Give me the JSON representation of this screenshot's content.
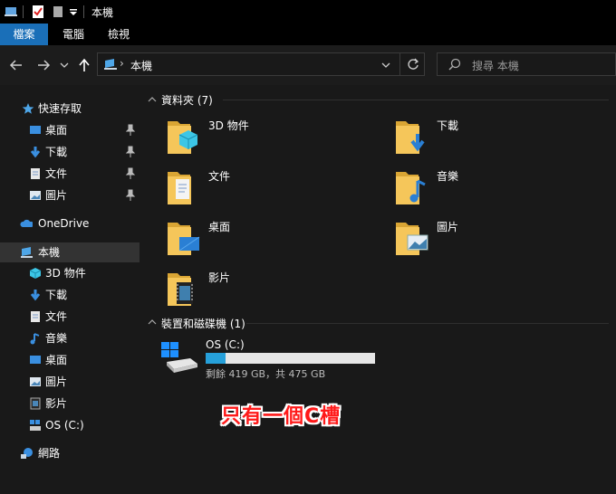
{
  "window": {
    "title": "本機"
  },
  "ribbon": {
    "tabs": [
      "檔案",
      "電腦",
      "檢視"
    ]
  },
  "address": {
    "path": "本機"
  },
  "search": {
    "placeholder": "搜尋 本機"
  },
  "sidebar": {
    "quick_access": "快速存取",
    "quick_items": [
      "桌面",
      "下載",
      "文件",
      "圖片"
    ],
    "onedrive": "OneDrive",
    "this_pc": "本機",
    "pc_items": [
      "3D 物件",
      "下載",
      "文件",
      "音樂",
      "桌面",
      "圖片",
      "影片",
      "OS (C:)"
    ],
    "network": "網路"
  },
  "folders_section": {
    "title": "資料夾 (7)",
    "items": [
      "3D 物件",
      "下載",
      "文件",
      "音樂",
      "桌面",
      "圖片",
      "影片"
    ]
  },
  "drives_section": {
    "title": "裝置和磁碟機 (1)",
    "drive": {
      "name": "OS (C:)",
      "space": "剩餘 419 GB，共 475 GB",
      "used_fraction": 0.12
    }
  },
  "annotation": "只有一個C槽",
  "colors": {
    "accent": "#0078d7",
    "folder": "#f5c65a",
    "callout": "#ff1a1a"
  }
}
